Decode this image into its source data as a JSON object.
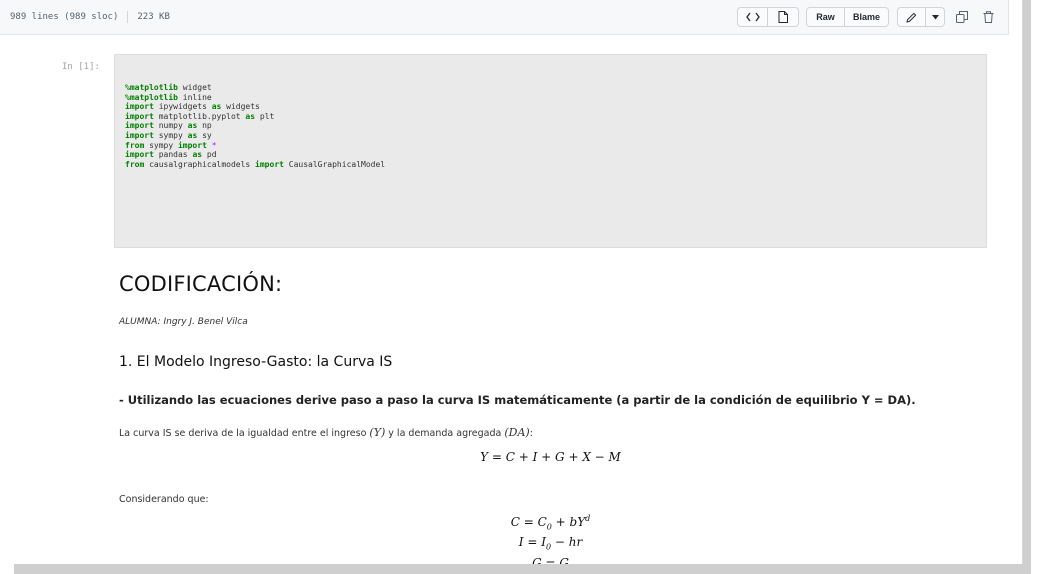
{
  "header": {
    "lines": "989 lines (989 sloc)",
    "size": "223 KB",
    "buttons": {
      "raw": "Raw",
      "blame": "Blame"
    },
    "icons": [
      "code-icon",
      "file-icon",
      "pencil-icon",
      "caret-down-icon",
      "copy-icon",
      "trash-icon"
    ]
  },
  "cell": {
    "prompt": "In [1]:",
    "code": [
      [
        {
          "t": "%matplotlib",
          "c": "kw"
        },
        {
          "t": " widget",
          "c": ""
        }
      ],
      [
        {
          "t": "%matplotlib",
          "c": "kw"
        },
        {
          "t": " inline",
          "c": ""
        }
      ],
      [
        {
          "t": "import",
          "c": "kw"
        },
        {
          "t": " ipywidgets ",
          "c": ""
        },
        {
          "t": "as",
          "c": "kw"
        },
        {
          "t": " widgets",
          "c": ""
        }
      ],
      [
        {
          "t": "import",
          "c": "kw"
        },
        {
          "t": " matplotlib.pyplot ",
          "c": ""
        },
        {
          "t": "as",
          "c": "kw"
        },
        {
          "t": " plt",
          "c": ""
        }
      ],
      [
        {
          "t": "import",
          "c": "kw"
        },
        {
          "t": " numpy ",
          "c": ""
        },
        {
          "t": "as",
          "c": "kw"
        },
        {
          "t": " np",
          "c": ""
        }
      ],
      [
        {
          "t": "import",
          "c": "kw"
        },
        {
          "t": " sympy ",
          "c": ""
        },
        {
          "t": "as",
          "c": "kw"
        },
        {
          "t": " sy",
          "c": ""
        }
      ],
      [
        {
          "t": "from",
          "c": "kw"
        },
        {
          "t": " sympy ",
          "c": ""
        },
        {
          "t": "import",
          "c": "kw"
        },
        {
          "t": " ",
          "c": ""
        },
        {
          "t": "*",
          "c": "op"
        }
      ],
      [
        {
          "t": "import",
          "c": "kw"
        },
        {
          "t": " pandas ",
          "c": ""
        },
        {
          "t": "as",
          "c": "kw"
        },
        {
          "t": " pd",
          "c": ""
        }
      ],
      [
        {
          "t": "from",
          "c": "kw"
        },
        {
          "t": " causalgraphicalmodels ",
          "c": ""
        },
        {
          "t": "import",
          "c": "kw"
        },
        {
          "t": " CausalGraphicalModel",
          "c": ""
        }
      ]
    ]
  },
  "markdown": {
    "title": "CODIFICACIÓN:",
    "author": "ALUMNA: Ingry J. Benel Vilca",
    "section": "1. El Modelo Ingreso-Gasto: la Curva IS",
    "question": "- Utilizando las ecuaciones derive paso a paso la curva IS matemáticamente (a partir de la condición de equilibrio Y = DA).",
    "para1_a": "La curva IS se deriva de la igualdad entre el ingreso ",
    "para1_m1": "(Y)",
    "para1_b": " y la demanda agregada ",
    "para1_m2": "(DA)",
    "para1_c": ":",
    "eq1": "Y = C + I + G + X − M",
    "para2": "Considerando que:",
    "eq2_a": "C = C",
    "eq2_sub": "0",
    "eq2_b": " + bY",
    "eq2_sup": "d",
    "eq3_a": "I = I",
    "eq3_sub": "0",
    "eq3_b": " − hr",
    "eq4": "G = G"
  }
}
